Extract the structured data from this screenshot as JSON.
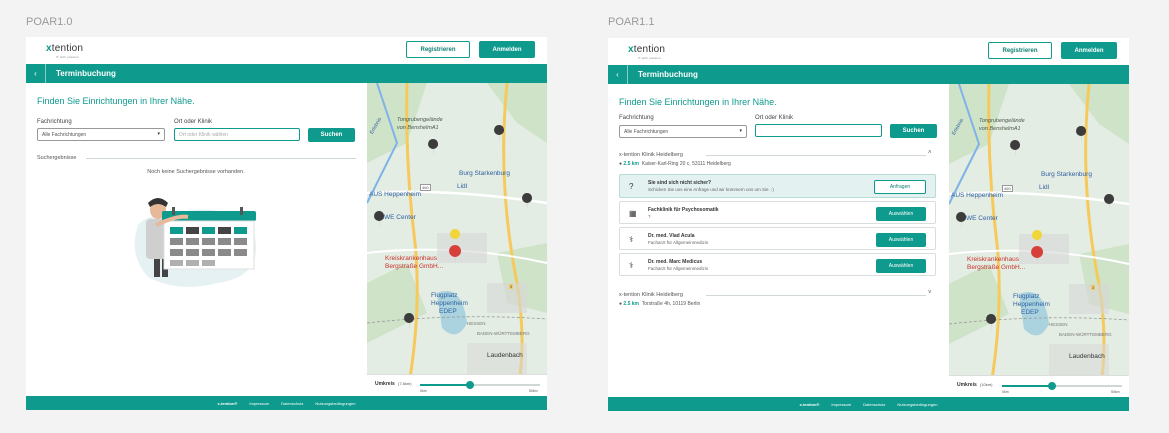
{
  "frames": [
    {
      "label": "POAR1.0",
      "logo": {
        "brand_x": "x",
        "brand_rest": "tention",
        "sub": "IT with passion"
      },
      "header": {
        "register": "Registrieren",
        "login": "Anmelden"
      },
      "bar": {
        "back": "‹",
        "title": "Terminbuchung"
      },
      "heading": "Finden Sie Einrichtungen in Ihrer Nähe.",
      "form": {
        "specialty_label": "Fachrichtung",
        "specialty_value": "Alle Fachrichtungen",
        "place_label": "Ort oder Klinik",
        "place_placeholder": "Ort oder Klinik wählen",
        "search": "Suchen"
      },
      "results": {
        "label": "Suchergebnisse",
        "empty": "Noch keine Suchergebnisse vorhanden."
      },
      "radius": {
        "label": "Umkreis",
        "value": "(7.6km)",
        "min": "0km",
        "max": "50km",
        "fraction": 0.42
      },
      "footer": {
        "brand": "x-tention®",
        "links": [
          "Impressum",
          "Datenschutz",
          "Nutzungsbedingungen"
        ]
      }
    },
    {
      "label": "POAR1.1",
      "logo": {
        "brand_x": "x",
        "brand_rest": "tention",
        "sub": "IT with passion"
      },
      "header": {
        "register": "Registrieren",
        "login": "Anmelden"
      },
      "bar": {
        "back": "‹",
        "title": "Terminbuchung"
      },
      "heading": "Finden Sie Einrichtungen in Ihrer Nähe.",
      "form": {
        "specialty_label": "Fachrichtung",
        "specialty_value": "Alle Fachrichtungen",
        "place_label": "Ort oder Klinik",
        "place_placeholder": "",
        "search": "Suchen"
      },
      "clinics": [
        {
          "name": "x-tention Klinik Heidelberg",
          "km": "2.5 km",
          "address": "Kaiser-Karl-Ring 20 c, 53111 Heidelberg",
          "expanded": true,
          "items": [
            {
              "title": "Sie sind sich nicht sicher?",
              "sub": "Schicken Sie uns eine Anfrage und wir kümmern uns um Sie. :)",
              "action": "Anfragen",
              "icon": "question-icon"
            },
            {
              "title": "Fachklinik für Psychosomatik",
              "sub": "?",
              "action": "Auswählen",
              "icon": "building-icon"
            },
            {
              "title": "Dr. med. Vlad Acula",
              "sub": "Facharzt für Allgemeinmedizin",
              "action": "Auswählen",
              "icon": "stethoscope-icon"
            },
            {
              "title": "Dr. med. Marc Medicus",
              "sub": "Facharzt für Allgemeinmedizin",
              "action": "Auswählen",
              "icon": "stethoscope-icon"
            }
          ]
        },
        {
          "name": "x-tention Klinik Heidelberg",
          "km": "2.5 km",
          "address": "Torstraße 4h, 10119 Berlin",
          "expanded": false,
          "items": []
        }
      ],
      "radius": {
        "label": "Umkreis",
        "value": "(10km)",
        "min": "0km",
        "max": "50km",
        "fraction": 0.42
      },
      "footer": {
        "brand": "x-tention®",
        "links": [
          "Impressum",
          "Datenschutz",
          "Nutzungsbedingungen"
        ]
      }
    }
  ],
  "map": {
    "labels": [
      "Tongrubengelände",
      "von BenshelmA1",
      "Burg Starkenburg",
      "Lidl",
      "AUS Heppenheim",
      "REWE Center",
      "Kreiskrankenhaus",
      "Bergstraße GmbH...",
      "Flugplatz",
      "Heppenheim",
      "EDEP",
      "HESSEN",
      "BADEN-WÜRTTEMBERG",
      "Laudenbach",
      "Erlebnis"
    ],
    "road_numbers": [
      "460",
      "3"
    ]
  },
  "colors": {
    "teal": "#0e9a8c",
    "teal_light": "#e3f2f0"
  }
}
